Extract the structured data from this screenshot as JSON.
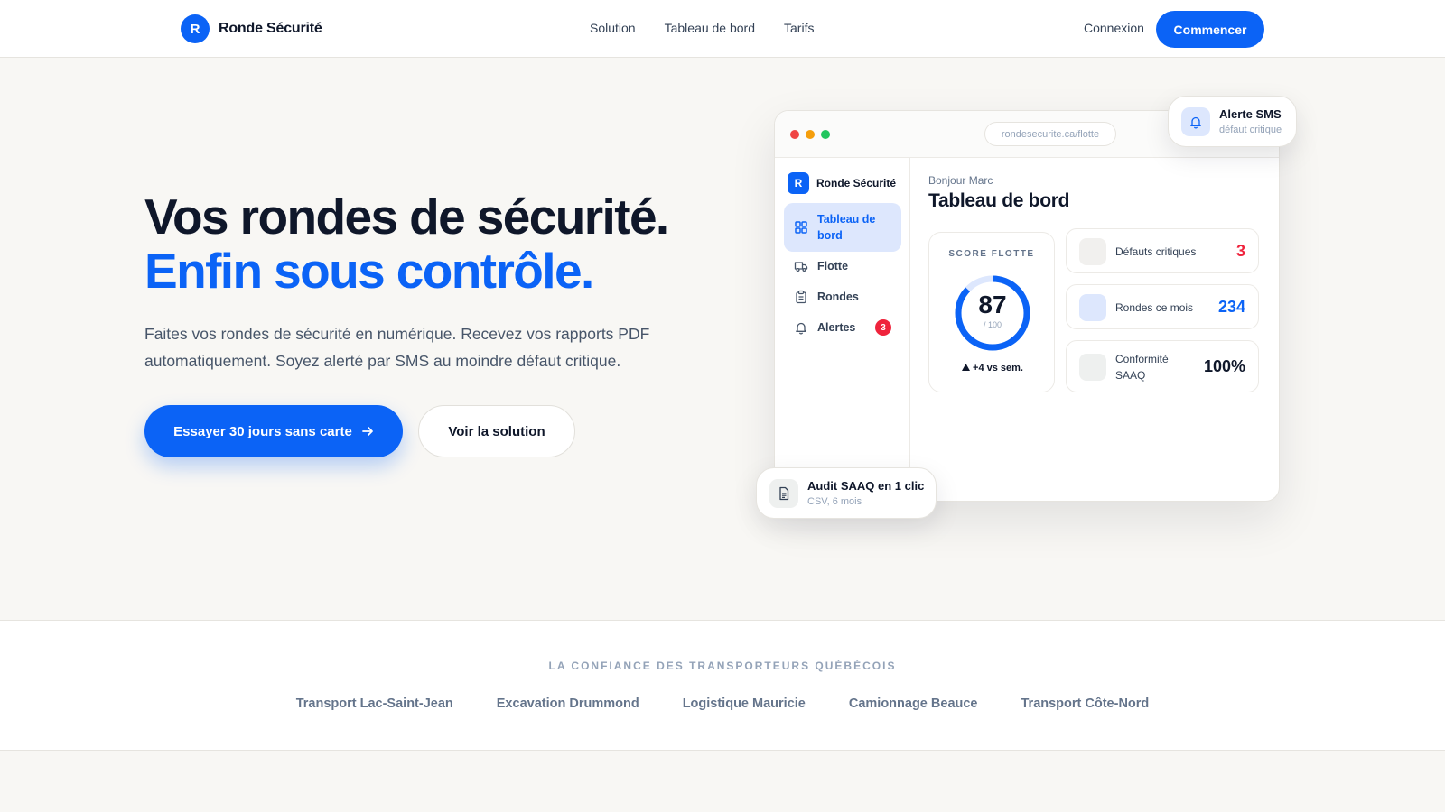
{
  "header": {
    "brand_initial": "R",
    "brand_name": "Ronde Sécurité",
    "nav": [
      "Solution",
      "Tableau de bord",
      "Tarifs"
    ],
    "login_label": "Connexion",
    "cta_label": "Commencer"
  },
  "hero": {
    "title_line1": "Vos rondes de sécurité.",
    "title_line2": "Enfin sous contrôle.",
    "description": "Faites vos rondes de sécurité en numérique. Recevez vos rapports PDF automatiquement. Soyez alerté par SMS au moindre défaut critique.",
    "primary_button": "Essayer 30 jours sans carte",
    "secondary_button": "Voir la solution"
  },
  "mockup": {
    "url": "rondesecurite.ca/flotte",
    "sidebar": {
      "brand_initial": "R",
      "brand_name": "Ronde Sécurité",
      "items": [
        {
          "label": "Tableau de bord",
          "icon": "grid-icon"
        },
        {
          "label": "Flotte",
          "icon": "truck-icon"
        },
        {
          "label": "Rondes",
          "icon": "clipboard-icon"
        },
        {
          "label": "Alertes",
          "icon": "bell-icon",
          "badge": "3"
        }
      ]
    },
    "greeting": "Bonjour Marc",
    "title": "Tableau de bord",
    "score": {
      "label": "SCORE FLOTTE",
      "value": "87",
      "max": "/ 100",
      "progress": 0.87,
      "delta": "+4 vs sem."
    },
    "stats": [
      {
        "label": "Défauts critiques",
        "value": "3",
        "color": "#ef233c"
      },
      {
        "label": "Rondes ce mois",
        "value": "234",
        "color": "#0b63f6"
      },
      {
        "label": "Conformité SAAQ",
        "value": "100%",
        "color": "#0f172a"
      }
    ]
  },
  "floating": {
    "sms_title": "Alerte SMS",
    "sms_sub": "défaut critique",
    "audit_title": "Audit SAAQ en 1 clic",
    "audit_sub": "CSV, 6 mois"
  },
  "trust": {
    "label": "LA CONFIANCE DES TRANSPORTEURS QUÉBÉCOIS",
    "companies": [
      "Transport Lac-Saint-Jean",
      "Excavation Drummond",
      "Logistique Mauricie",
      "Camionnage Beauce",
      "Transport Côte-Nord"
    ]
  },
  "colors": {
    "accent": "#0b63f6",
    "danger": "#ef233c"
  }
}
